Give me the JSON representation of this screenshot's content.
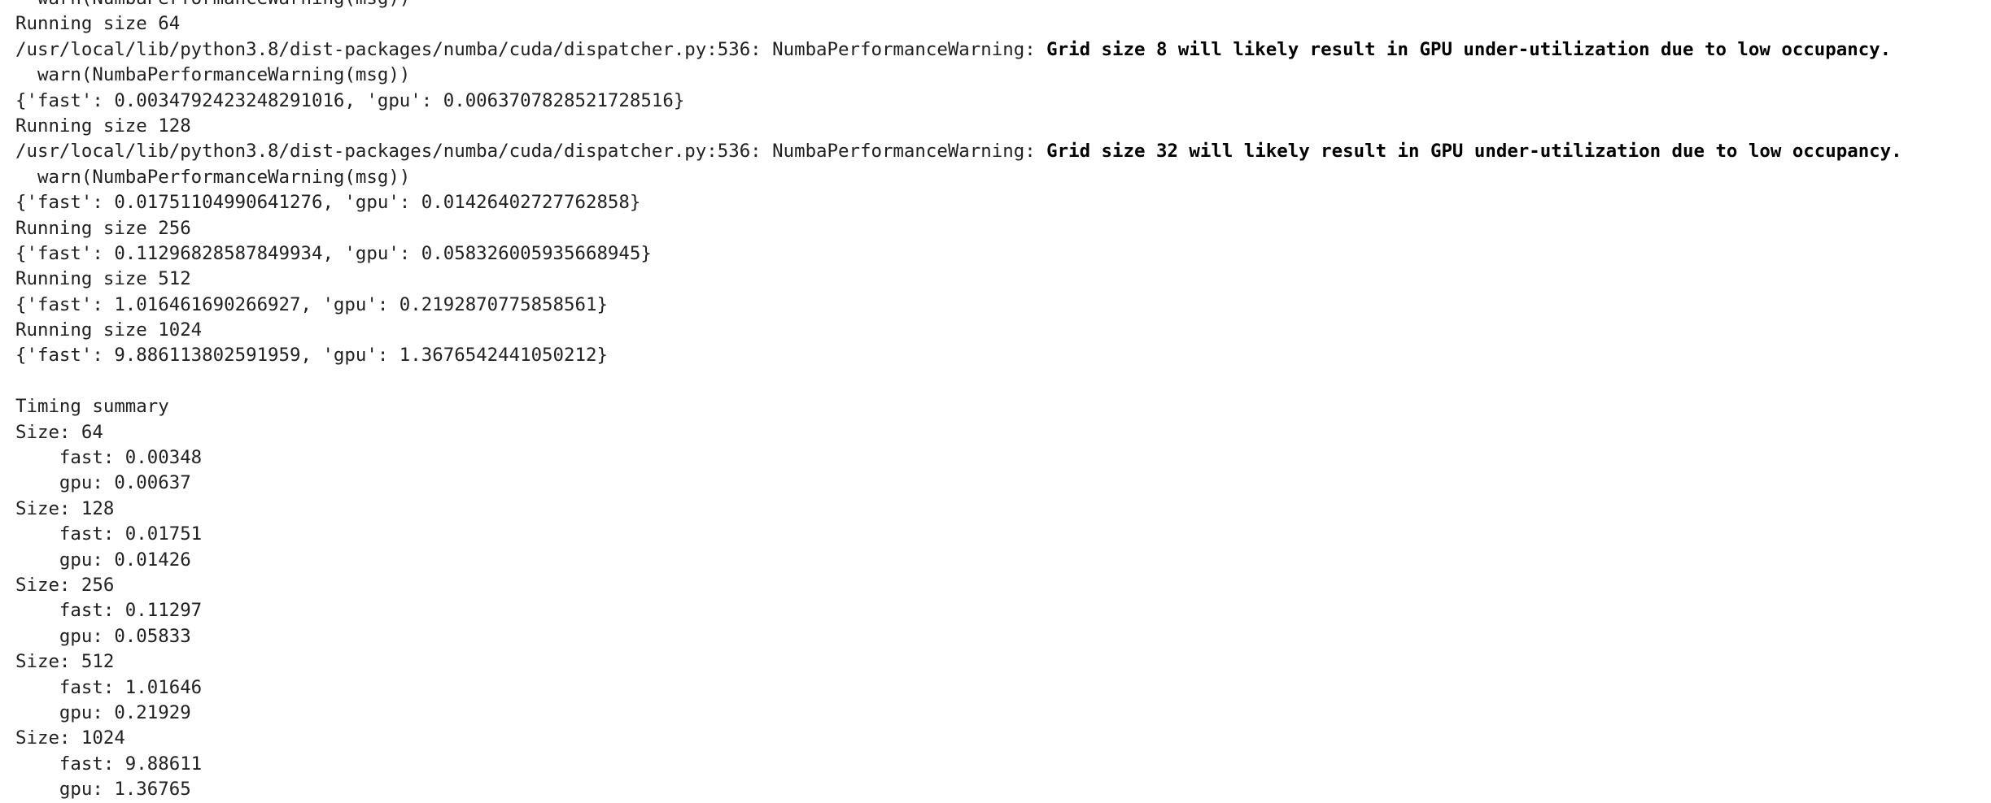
{
  "output": {
    "lines": [
      {
        "text": "  warn(NumbaPerformanceWarning(msg))"
      },
      {
        "text": "Running size 64"
      },
      {
        "text": "/usr/local/lib/python3.8/dist-packages/numba/cuda/dispatcher.py:536: NumbaPerformanceWarning: ",
        "warning": "Grid size 8 will likely result in GPU under-utilization due to low occupancy."
      },
      {
        "text": "  warn(NumbaPerformanceWarning(msg))"
      },
      {
        "text": "{'fast': 0.0034792423248291016, 'gpu': 0.006370782852172851 6}"
      },
      {
        "text": "Running size 128"
      },
      {
        "text": "/usr/local/lib/python3.8/dist-packages/numba/cuda/dispatcher.py:536: NumbaPerformanceWarning: ",
        "warning": "Grid size 32 will likely result in GPU under-utilization due to low occupancy."
      },
      {
        "text": "  warn(NumbaPerformanceWarning(msg))"
      },
      {
        "text": "{'fast': 0.01751104990641276, 'gpu': 0.01426402727762858}"
      },
      {
        "text": "Running size 256"
      },
      {
        "text": "{'fast': 0.11296828587849934, 'gpu': 0.058326005935668945}"
      },
      {
        "text": "Running size 512"
      },
      {
        "text": "{'fast': 1.016461690266927, 'gpu': 0.2192870775858561}"
      },
      {
        "text": "Running size 1024"
      },
      {
        "text": "{'fast': 9.886113802591959, 'gpu': 1.3676542441050212}"
      },
      {
        "text": ""
      },
      {
        "text": "Timing summary"
      },
      {
        "text": "Size: 64"
      },
      {
        "text": "    fast: 0.00348"
      },
      {
        "text": "    gpu: 0.00637"
      },
      {
        "text": "Size: 128"
      },
      {
        "text": "    fast: 0.01751"
      },
      {
        "text": "    gpu: 0.01426"
      },
      {
        "text": "Size: 256"
      },
      {
        "text": "    fast: 0.11297"
      },
      {
        "text": "    gpu: 0.05833"
      },
      {
        "text": "Size: 512"
      },
      {
        "text": "    fast: 1.01646"
      },
      {
        "text": "    gpu: 0.21929"
      },
      {
        "text": "Size: 1024"
      },
      {
        "text": "    fast: 9.88611"
      },
      {
        "text": "    gpu: 1.36765"
      }
    ]
  }
}
